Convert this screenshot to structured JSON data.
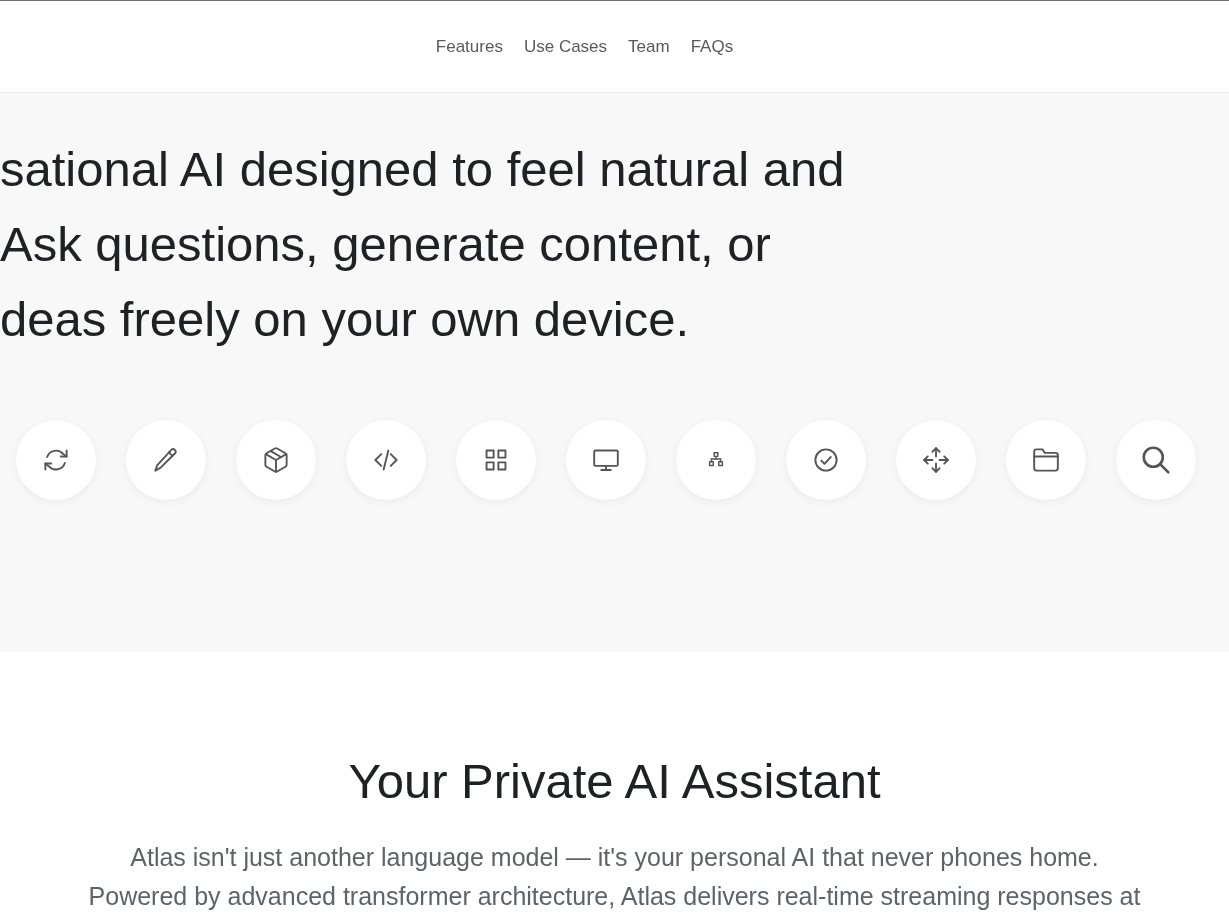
{
  "nav": {
    "links": [
      "Features",
      "Use Cases",
      "Team",
      "FAQs"
    ]
  },
  "hero": {
    "text_lines": [
      "sational AI designed to feel natural and",
      "Ask questions, generate content, or",
      "deas freely on your own device."
    ],
    "icons": [
      {
        "kind": "refresh"
      },
      {
        "kind": "pencil"
      },
      {
        "kind": "box"
      },
      {
        "kind": "code"
      },
      {
        "kind": "grid"
      },
      {
        "kind": "monitor"
      },
      {
        "kind": "hierarchy"
      },
      {
        "kind": "check"
      },
      {
        "kind": "move"
      },
      {
        "kind": "folder"
      },
      {
        "kind": "search"
      }
    ]
  },
  "about": {
    "title": "Your Private AI Assistant",
    "text_lines": [
      "Atlas isn't just another language model — it's your personal AI that never phones home.",
      "Powered by advanced transformer architecture, Atlas delivers real-time streaming responses at"
    ]
  }
}
